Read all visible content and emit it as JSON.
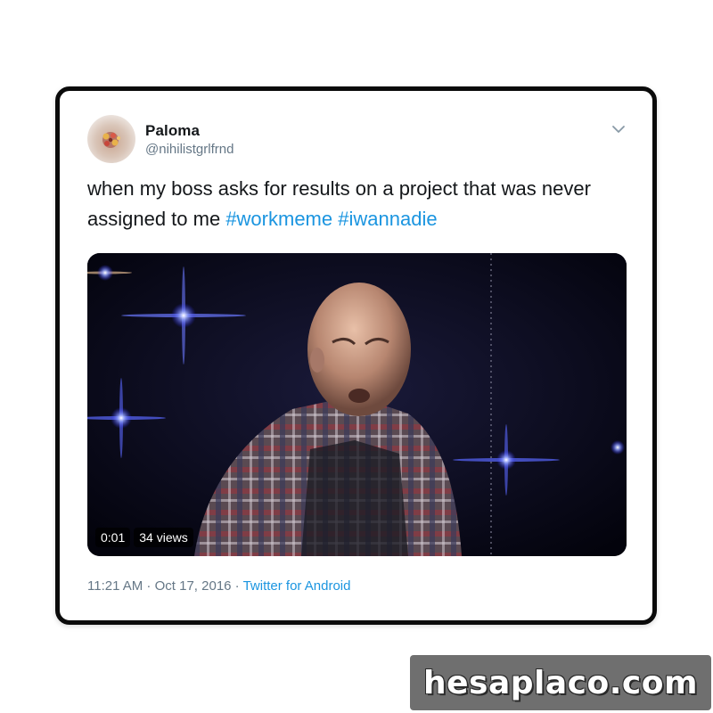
{
  "tweet": {
    "display_name": "Paloma",
    "handle": "@nihilistgrlfrnd",
    "text": "when my boss asks for results on a project that was never assigned to me ",
    "hashtags": [
      "#workmeme",
      "#iwannadie"
    ],
    "time": "11:21 AM",
    "separator": " · ",
    "date": "Oct 17, 2016",
    "source": "Twitter for Android"
  },
  "video": {
    "duration": "0:01",
    "views": "34 views"
  },
  "icons": {
    "avatar": "avatar-image",
    "menu": "chevron-down-icon"
  },
  "colors": {
    "link": "#1b95e0",
    "text": "#14171a",
    "muted": "#657786",
    "frame": "#0a0a0a"
  },
  "watermark": {
    "text": "hesaplaco.com"
  }
}
